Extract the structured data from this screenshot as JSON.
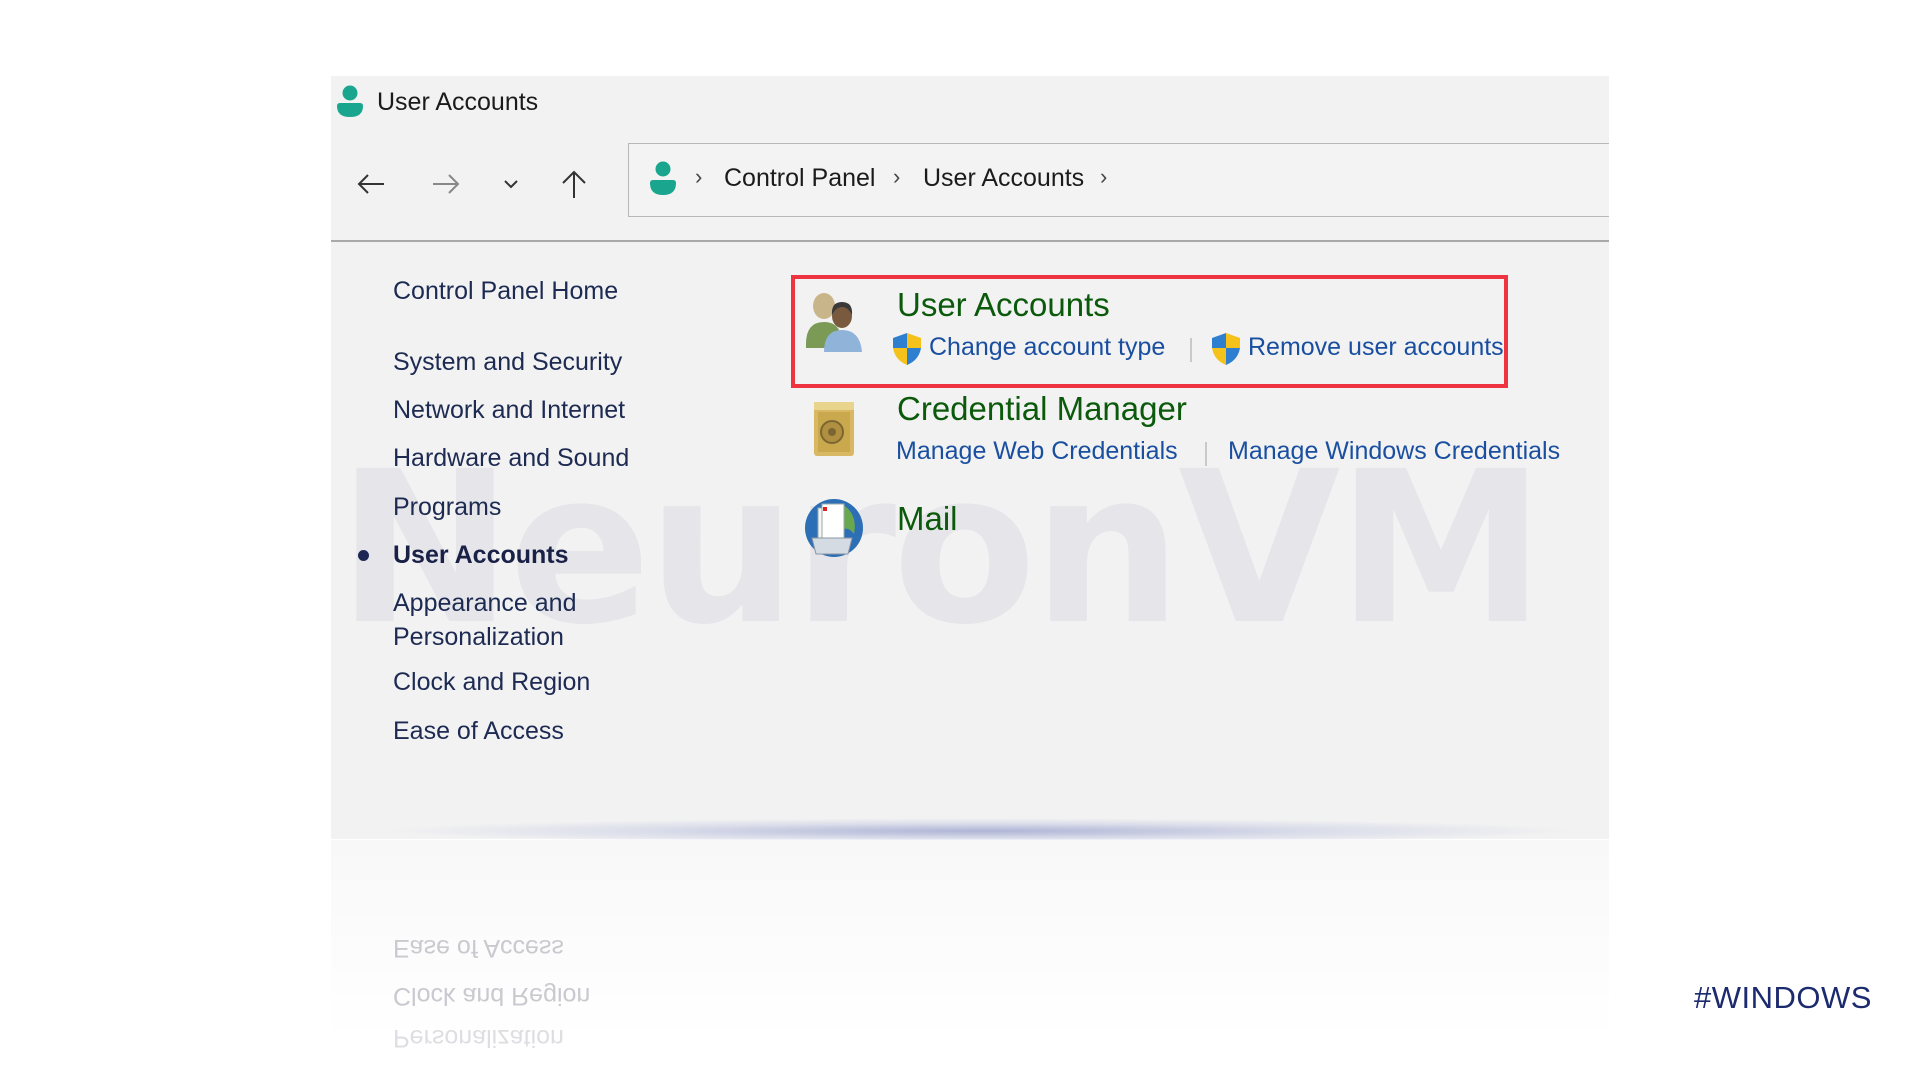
{
  "window": {
    "title": "User Accounts",
    "title_icon": "user-icon"
  },
  "navigation": {
    "back_icon": "arrow-left-icon",
    "forward_icon": "arrow-right-icon",
    "recent_icon": "chevron-down-icon",
    "up_icon": "arrow-up-icon"
  },
  "address_bar": {
    "icon": "user-icon",
    "breadcrumbs": [
      "Control Panel",
      "User Accounts"
    ],
    "separator": "›"
  },
  "sidebar": {
    "items": [
      {
        "label": "Control Panel Home",
        "active": false
      },
      {
        "label": "System and Security",
        "active": false
      },
      {
        "label": "Network and Internet",
        "active": false
      },
      {
        "label": "Hardware and Sound",
        "active": false
      },
      {
        "label": "Programs",
        "active": false
      },
      {
        "label": "User Accounts",
        "active": true
      },
      {
        "label": "Appearance and",
        "label_line2": "Personalization",
        "active": false
      },
      {
        "label": "Clock and Region",
        "active": false
      },
      {
        "label": "Ease of Access",
        "active": false
      }
    ]
  },
  "categories": [
    {
      "title": "User Accounts",
      "icon": "users-icon",
      "highlighted": true,
      "links": [
        {
          "label": "Change account type",
          "icon": "uac-shield-icon"
        },
        {
          "label": "Remove user accounts",
          "icon": "uac-shield-icon"
        }
      ]
    },
    {
      "title": "Credential Manager",
      "icon": "vault-icon",
      "links": [
        {
          "label": "Manage Web Credentials"
        },
        {
          "label": "Manage Windows Credentials"
        }
      ]
    },
    {
      "title": "Mail",
      "icon": "mail-globe-icon",
      "links": []
    }
  ],
  "colors": {
    "highlight_border": "#ef3340",
    "category_title": "#0b5a0b",
    "link": "#1a4fa0",
    "sidebar_text": "#1d2a52",
    "hashtag": "#1c2a6e"
  },
  "watermark": "NeuronVM",
  "hashtag": "#WINDOWS"
}
